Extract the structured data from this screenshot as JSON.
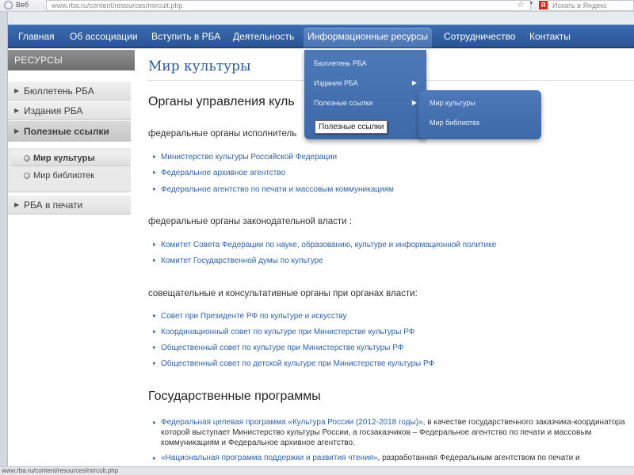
{
  "browser": {
    "web_label": "Веб",
    "url": "www.rba.ru/content/resources/mircult.php",
    "search_placeholder": "Искать в Яндекс",
    "search_logo": "Я",
    "status_url": "www.rba.ru/content/resources/mircult.php"
  },
  "nav": {
    "items": [
      {
        "label": "Главная"
      },
      {
        "label": "Об ассоциации"
      },
      {
        "label": "Вступить в РБА"
      },
      {
        "label": "Деятельность"
      },
      {
        "label": "Информационные ресурсы"
      },
      {
        "label": "Сотрудничество"
      },
      {
        "label": "Контакты"
      }
    ]
  },
  "sidebar": {
    "header": "РЕСУРСЫ",
    "items": [
      {
        "label": "Бюллетень РБА"
      },
      {
        "label": "Издания РБА"
      },
      {
        "label": "Полезные ссылки"
      },
      {
        "label": "РБА в печати"
      }
    ],
    "subitems": [
      {
        "label": "Мир культуры"
      },
      {
        "label": "Мир библиотек"
      }
    ]
  },
  "dropdown": {
    "items": [
      {
        "label": "Бюллетень РБА"
      },
      {
        "label": "Издания РБА"
      },
      {
        "label": "Полезные ссылки"
      }
    ],
    "submenu": [
      {
        "label": "Мир культуры"
      },
      {
        "label": "Мир библиотек"
      }
    ],
    "tooltip": "Полезные ссылки"
  },
  "main": {
    "title": "Мир культуры",
    "sections": {
      "governance_title": "Органы управления куль",
      "executive_label": "федеральные органы исполнитель",
      "executive_links": [
        "Министерство культуры Российской Федерации",
        "Федеральное архивное агентство",
        "Федеральное агентство по печати и массовым коммуникациям"
      ],
      "legislative_label": "федеральные органы законодательной власти :",
      "legislative_links": [
        "Комитет Совета Федерации по науке, образованию, культуре и информационной политике",
        "Комитет Государственной думы по культуре"
      ],
      "advisory_label": "совещательные и консультативные органы при органах власти:",
      "advisory_links": [
        "Совет при Президенте РФ по культуре и искусству",
        "Координационный совет по культуре при Министерстве культуры РФ",
        "Общественный совет по культуре при Министерстве культуры РФ",
        "Общественный совет по детской культуре при Министерстве культуры РФ"
      ],
      "programs_title": "Государственные программы",
      "program1_link": "Федеральная целевая программа «Культура России (2012-2018 годы)»",
      "program1_text": ", в качестве государственного заказчика-координатора которой выступает Министерство культуры России, а госзаказчиков – Федеральное агентство по печати и массовым коммуникациям и Федеральное архивное агентство.",
      "program2_link": "«Национальная программа поддержки и развития чтения»",
      "program2_text": ", разработанная Федеральным агентством по печати и"
    }
  }
}
